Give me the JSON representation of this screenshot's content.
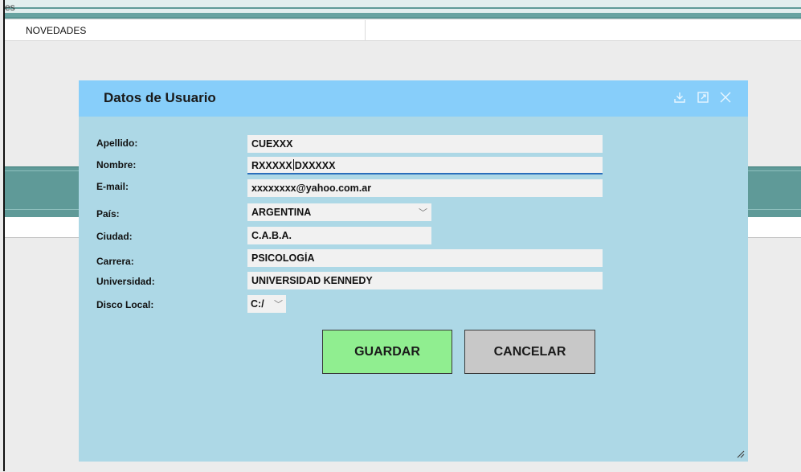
{
  "app": {
    "title_fragment": "es"
  },
  "menu": {
    "items": [
      {
        "label": "NOVEDADES"
      }
    ]
  },
  "dialog": {
    "title": "Datos de Usuario",
    "header_icons": [
      "download-icon",
      "maximize-icon",
      "close-icon"
    ],
    "fields": {
      "apellido": {
        "label": "Apellido:",
        "value": "CUEXXX"
      },
      "nombre": {
        "label": "Nombre:",
        "value_before_caret": "RXXXXX",
        "value_after_caret": "DXXXXX"
      },
      "email": {
        "label": "E-mail:",
        "value": "xxxxxxxx@yahoo.com.ar"
      },
      "pais": {
        "label": "País:",
        "value": "ARGENTINA"
      },
      "ciudad": {
        "label": "Ciudad:",
        "value": "C.A.B.A."
      },
      "carrera": {
        "label": "Carrera:",
        "value": "PSICOLOGÍA"
      },
      "universidad": {
        "label": "Universidad:",
        "value": "UNIVERSIDAD KENNEDY"
      },
      "disco": {
        "label": "Disco  Local:",
        "value": "C:/"
      }
    },
    "buttons": {
      "save_label": "GUARDAR",
      "cancel_label": "CANCELAR"
    }
  },
  "colors": {
    "dialog_header": "#87cefa",
    "dialog_body": "#add8e6",
    "save_button": "#90ee90",
    "cancel_button": "#c8c8c8",
    "teal_band": "#5f9a98"
  }
}
